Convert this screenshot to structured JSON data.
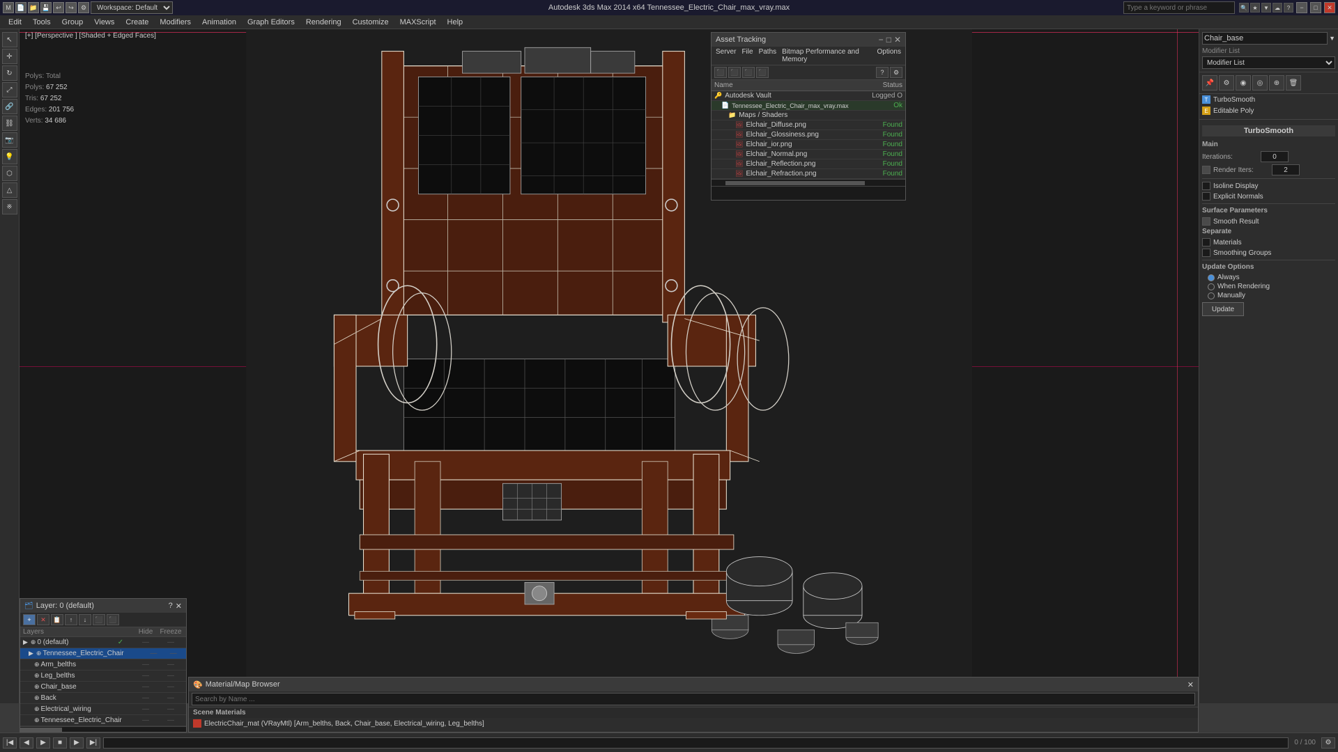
{
  "titlebar": {
    "app_name": "Autodesk 3ds Max 2014 x64",
    "file_name": "Tennessee_Electric_Chair_max_vray.max",
    "title": "Autodesk 3ds Max 2014 x64     Tennessee_Electric_Chair_max_vray.max",
    "minimize_label": "−",
    "maximize_label": "□",
    "close_label": "✕"
  },
  "search": {
    "placeholder": "Type a keyword or phrase"
  },
  "toolbar": {
    "workspace_label": "Workspace: Default",
    "tools": [
      "↩",
      "↪",
      "📁",
      "💾"
    ]
  },
  "menubar": {
    "items": [
      "Edit",
      "Tools",
      "Group",
      "Views",
      "Create",
      "Modifiers",
      "Animation",
      "Graph Editors",
      "Rendering",
      "Customize",
      "MAXScript",
      "Help"
    ]
  },
  "viewport": {
    "label": "[+] [Perspective ] [Shaded + Edged Faces]",
    "stats": {
      "polys_label": "Polys:",
      "polys_value": "67 252",
      "tris_label": "Tris:",
      "tris_value": "67 252",
      "edges_label": "Edges:",
      "edges_value": "201 756",
      "verts_label": "Verts:",
      "verts_value": "34 686"
    }
  },
  "modifier_panel": {
    "object_name": "Chair_base",
    "modifier_list_label": "Modifier List",
    "modifiers": [
      {
        "name": "TurboSmooth",
        "icon": "T",
        "color": "#4a90d9"
      },
      {
        "name": "Editable Poly",
        "icon": "E",
        "color": "#d4a017"
      }
    ],
    "turbosmooth": {
      "title": "TurboSmooth",
      "main_section": "Main",
      "iterations_label": "Iterations:",
      "iterations_value": "0",
      "render_iters_label": "Render Iters:",
      "render_iters_value": "2",
      "isoline_label": "Isoline Display",
      "explicit_normals_label": "Explicit Normals",
      "surface_params_label": "Surface Parameters",
      "smooth_result_label": "Smooth Result",
      "separate_label": "Separate",
      "materials_label": "Materials",
      "smoothing_groups_label": "Smoothing Groups",
      "update_options_label": "Update Options",
      "always_label": "Always",
      "when_rendering_label": "When Rendering",
      "manually_label": "Manually",
      "update_btn_label": "Update"
    }
  },
  "asset_tracking": {
    "title": "Asset Tracking",
    "menus": [
      "Server",
      "File",
      "Paths",
      "Bitmap Performance and Memory",
      "Options"
    ],
    "columns": {
      "name": "Name",
      "status": "Status"
    },
    "items": [
      {
        "name": "Autodesk Vault",
        "status": "Logged O",
        "indent": 0,
        "icon": "🔑"
      },
      {
        "name": "Tennessee_Electric_Chair_max_vray.max",
        "status": "Ok",
        "indent": 1,
        "icon": "📄",
        "highlight": true
      },
      {
        "name": "Maps / Shaders",
        "status": "",
        "indent": 2,
        "icon": "📁"
      },
      {
        "name": "Elchair_Diffuse.png",
        "status": "Found",
        "indent": 3,
        "icon": "🖼"
      },
      {
        "name": "Elchair_Glossiness.png",
        "status": "Found",
        "indent": 3,
        "icon": "🖼"
      },
      {
        "name": "Elchair_ior.png",
        "status": "Found",
        "indent": 3,
        "icon": "🖼"
      },
      {
        "name": "Elchair_Normal.png",
        "status": "Found",
        "indent": 3,
        "icon": "🖼"
      },
      {
        "name": "Elchair_Reflection.png",
        "status": "Found",
        "indent": 3,
        "icon": "🖼"
      },
      {
        "name": "Elchair_Refraction.png",
        "status": "Found",
        "indent": 3,
        "icon": "🖼"
      }
    ]
  },
  "layers_panel": {
    "title": "Layer: 0 (default)",
    "header": {
      "name": "Layers",
      "hide": "Hide",
      "freeze": "Freeze"
    },
    "layers": [
      {
        "name": "0 (default)",
        "indent": 0,
        "selected": false,
        "checkmark": "✓"
      },
      {
        "name": "Tennessee_Electric_Chair",
        "indent": 1,
        "selected": true,
        "checkmark": ""
      },
      {
        "name": "Arm_belths",
        "indent": 2,
        "selected": false,
        "checkmark": ""
      },
      {
        "name": "Leg_belths",
        "indent": 2,
        "selected": false,
        "checkmark": ""
      },
      {
        "name": "Chair_base",
        "indent": 2,
        "selected": false,
        "checkmark": ""
      },
      {
        "name": "Back",
        "indent": 2,
        "selected": false,
        "checkmark": ""
      },
      {
        "name": "Electrical_wiring",
        "indent": 2,
        "selected": false,
        "checkmark": ""
      },
      {
        "name": "Tennessee_Electric_Chair",
        "indent": 2,
        "selected": false,
        "checkmark": ""
      }
    ]
  },
  "material_browser": {
    "title": "Material/Map Browser",
    "search_placeholder": "Search by Name ...",
    "section_label": "Scene Materials",
    "material_name": "ElectricChair_mat (VRayMtl) [Arm_belths, Back, Chair_base, Electrical_wiring, Leg_belths]",
    "material_color": "#c0392b"
  },
  "bottom_controls": {
    "frame_start": "0",
    "frame_end": "100",
    "play_label": "▶",
    "stop_label": "■"
  }
}
